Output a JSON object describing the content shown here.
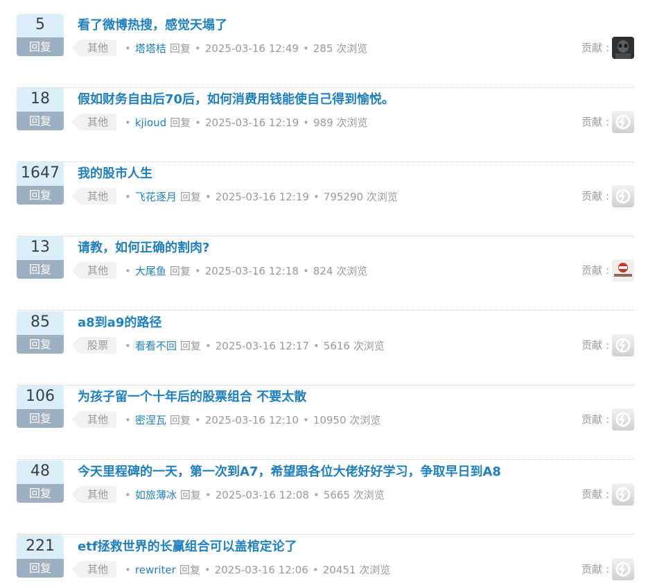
{
  "reply_label": "回复",
  "contrib_label": "贡献 :",
  "views_suffix": "次浏览",
  "topics": [
    {
      "count": "5",
      "title": "看了微博热搜，感觉天塌了",
      "tag": "其他",
      "author": "塔塔桔",
      "action": "回复",
      "time": "2025-03-16 12:49",
      "views": "285",
      "avatar": "dark-photo-avatar"
    },
    {
      "count": "18",
      "title": "假如财务自由后70后，如何消费用钱能使自己得到愉悦。",
      "tag": "其他",
      "author": "kjioud",
      "action": "回复",
      "time": "2025-03-16 12:19",
      "views": "989",
      "avatar": "default-avatar"
    },
    {
      "count": "1647",
      "title": "我的股市人生",
      "tag": "其他",
      "author": "飞花逐月",
      "action": "回复",
      "time": "2025-03-16 12:19",
      "views": "795290",
      "avatar": "default-avatar"
    },
    {
      "count": "13",
      "title": "请教，如何正确的割肉?",
      "tag": "其他",
      "author": "大尾鱼",
      "action": "回复",
      "time": "2025-03-16 12:18",
      "views": "824",
      "avatar": "logo-avatar"
    },
    {
      "count": "85",
      "title": "a8到a9的路径",
      "tag": "股票",
      "author": "看看不回",
      "action": "回复",
      "time": "2025-03-16 12:17",
      "views": "5616",
      "avatar": "default-avatar"
    },
    {
      "count": "106",
      "title": "为孩子留一个十年后的股票组合 不要太散",
      "tag": "其他",
      "author": "密涅瓦",
      "action": "回复",
      "time": "2025-03-16 12:10",
      "views": "10950",
      "avatar": "default-avatar"
    },
    {
      "count": "48",
      "title": "今天里程碑的一天，第一次到A7，希望跟各位大佬好好学习，争取早日到A8",
      "tag": "其他",
      "author": "如旅薄冰",
      "action": "回复",
      "time": "2025-03-16 12:08",
      "views": "5665",
      "avatar": "default-avatar"
    },
    {
      "count": "221",
      "title": "etf拯救世界的长赢组合可以盖棺定论了",
      "tag": "其他",
      "author": "rewriter",
      "action": "回复",
      "time": "2025-03-16 12:06",
      "views": "20451",
      "avatar": "default-avatar"
    }
  ]
}
